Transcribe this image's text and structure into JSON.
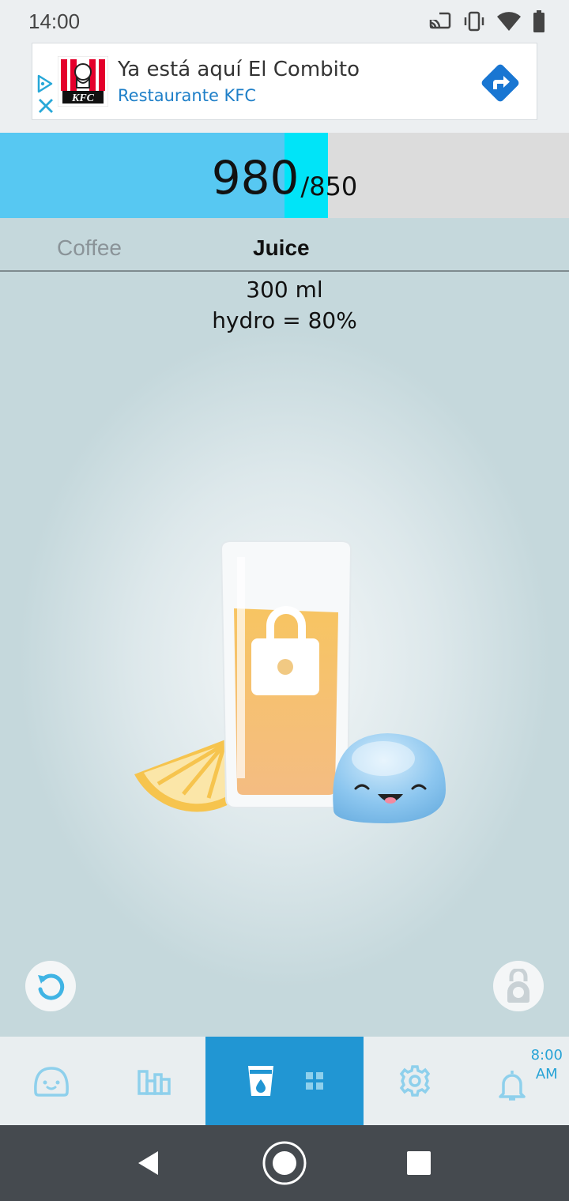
{
  "status_bar": {
    "time": "14:00",
    "icons": [
      "cast-icon",
      "vibrate-icon",
      "wifi-icon",
      "battery-icon"
    ]
  },
  "ad": {
    "title": "Ya está aquí El Combito",
    "subtitle": "Restaurante KFC",
    "logo_text": "KFC",
    "icons": [
      "ad-choices-icon",
      "close-icon",
      "directions-icon"
    ]
  },
  "progress": {
    "current": "980",
    "goal": "/850",
    "fill_fraction": 0.5,
    "extra_fraction": 0.076,
    "colors": {
      "fill": "#57c8f2",
      "extra": "#00e4f8",
      "track": "#dcdcdc"
    }
  },
  "tabs": [
    {
      "label": "Coffee",
      "active": false
    },
    {
      "label": "Juice",
      "active": true
    }
  ],
  "drink": {
    "volume": "300 ml",
    "hydro": "hydro = 80%",
    "locked": true
  },
  "actions": {
    "undo_icon": "undo-icon",
    "weight_icon": "kettlebell-icon"
  },
  "bottom_nav": {
    "items": [
      "face-icon",
      "stats-icon",
      "drink-icon",
      "settings-icon",
      "bell-icon"
    ],
    "active": "drink",
    "reminder_time": "8:00",
    "reminder_ampm": "AM"
  },
  "system_nav": [
    "back-icon",
    "home-icon",
    "recents-icon"
  ]
}
